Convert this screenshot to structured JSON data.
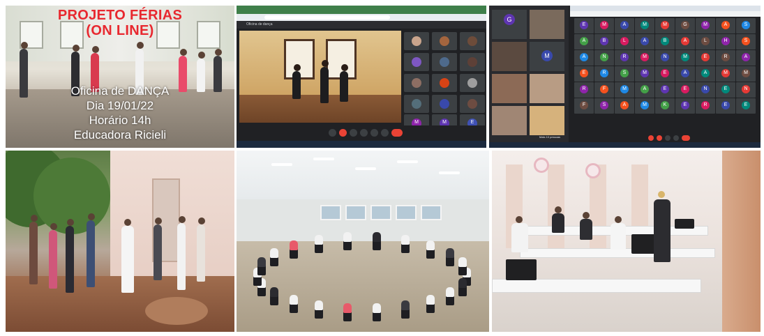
{
  "panel1": {
    "title_line1": "PROJETO FÉRIAS",
    "title_line2": "(ON LINE)",
    "caption_line1": "Oficina de DANÇA",
    "caption_line2": "Dia 19/01/22",
    "caption_line3": "Horário 14h",
    "caption_line4": "Educadora Ricieli"
  },
  "colors": {
    "title_red": "#e8282f",
    "caption_white": "#ffffff",
    "meet_dark": "#202124",
    "meet_tile": "#3c4043",
    "end_call_red": "#ea4335"
  },
  "panel2": {
    "meeting_title": "Oficina de dança",
    "tile_letters": [
      "M",
      "M",
      "E"
    ],
    "tile_names": [
      "",
      "",
      "",
      "",
      "",
      "",
      "",
      "",
      "",
      "",
      "",
      "",
      "",
      ""
    ],
    "icons": [
      "mic-icon",
      "camera-icon",
      "captions-icon",
      "raise-hand-icon",
      "present-icon",
      "more-icon",
      "end-call-icon"
    ]
  },
  "panel3": {
    "left_letters": [
      "G",
      "M"
    ],
    "grid_letters": [
      "E",
      "M",
      "A",
      "M",
      "M",
      "G",
      "M",
      "A",
      "S",
      "A",
      "B",
      "L",
      "A",
      "B",
      "A",
      "L",
      "H",
      "S",
      "A",
      "N",
      "R",
      "M",
      "N",
      "M",
      "E",
      "R",
      "A",
      "E",
      "R",
      "S",
      "M",
      "E",
      "A",
      "A",
      "M",
      "M",
      "R",
      "F",
      "M",
      "A",
      "E",
      "E",
      "N",
      "E",
      "N",
      "F",
      "S",
      "A",
      "M",
      "K",
      "E",
      "R",
      "E",
      "E"
    ],
    "bottom_label": "Mais 10 pessoas"
  },
  "panel4": {
    "scene": "outdoor-group"
  },
  "panel5": {
    "scene": "hall-circle"
  },
  "panel6": {
    "scene": "computer-lab"
  }
}
